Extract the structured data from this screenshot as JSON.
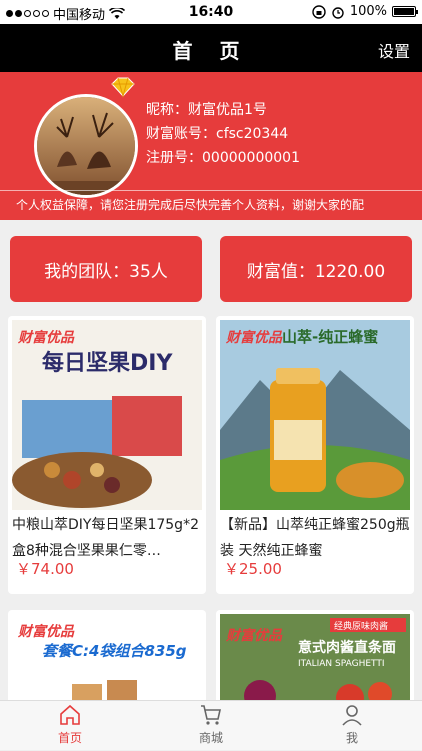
{
  "status_bar": {
    "carrier": "中国移动",
    "time": "16:40",
    "battery": "100%"
  },
  "nav": {
    "title": "首 页",
    "settings_label": "设置"
  },
  "profile": {
    "nickname": "昵称：财富优品1号",
    "account": "财富账号：cfsc20344",
    "register_no": "注册号：00000000001",
    "notice": "个人权益保障，请您注册完成后尽快完善个人资料，谢谢大家的配"
  },
  "stats": {
    "team": "我的团队：35人",
    "wealth": "财富值：1220.00"
  },
  "products": [
    {
      "brand": "财富优品",
      "banner": "每日坚果DIY",
      "title": "中粮山萃DIY每日坚果175g*2盒8种混合坚果果仁零…",
      "price": "￥74.00"
    },
    {
      "brand": "财富优品",
      "banner": "山萃-纯正蜂蜜",
      "title": "【新品】山萃纯正蜂蜜250g瓶装 天然纯正蜂蜜",
      "price": "￥25.00"
    },
    {
      "brand": "财富优品",
      "banner": "套餐C:4袋组合835g"
    },
    {
      "brand": "财富优品",
      "banner": "意式肉酱直条面",
      "tag": "经典原味肉酱",
      "sub": "ITALIAN SPAGHETTI"
    }
  ],
  "tabbar": {
    "home": "首页",
    "mall": "商城",
    "me": "我"
  },
  "colors": {
    "accent": "#e63c3c",
    "nav_bg": "#000000"
  }
}
